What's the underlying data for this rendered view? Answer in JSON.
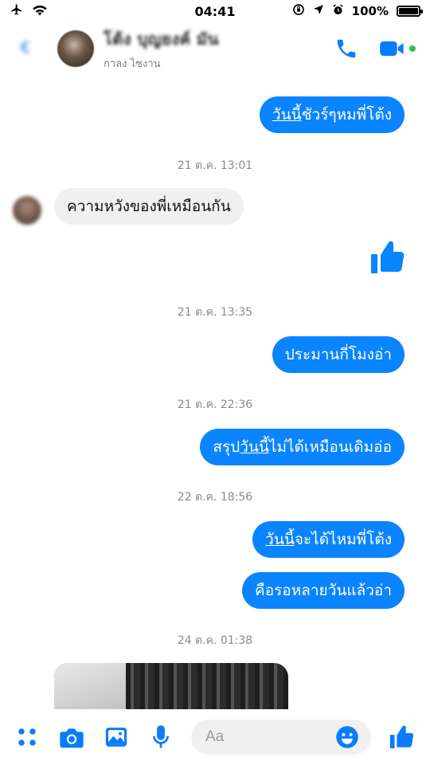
{
  "status_bar": {
    "time": "04:41",
    "battery_percent": "100%",
    "battery_level": 1.0,
    "icons": [
      "airplane-icon",
      "wifi-icon",
      "rotation-lock-icon",
      "location-icon",
      "alarm-icon",
      "battery-icon"
    ]
  },
  "header": {
    "contact_name": "โต้ง บุญยงค์ มัน",
    "contact_status": "กาลง ไซงาน",
    "icons": [
      "back-icon",
      "phone-icon",
      "video-call-icon"
    ],
    "accent_color": "#0a7cff",
    "active_color": "#31c24d"
  },
  "messages": {
    "m1": {
      "direction": "outgoing",
      "prefix": "วันนี้",
      "rest": "ชัวร์ๆหมพี่โต้ง"
    },
    "ts1": "21 ต.ค. 13:01",
    "m2": {
      "direction": "incoming",
      "text": "ความหวังของพี่เหมือนกัน"
    },
    "m3": {
      "direction": "outgoing",
      "type": "like-sticker"
    },
    "ts2": "21 ต.ค. 13:35",
    "m4": {
      "direction": "outgoing",
      "text": "ประมานกี่โมงอ่า"
    },
    "ts3": "21 ต.ค. 22:36",
    "m5": {
      "direction": "outgoing",
      "lead": "สรุป",
      "prefix": "วันนี้",
      "rest": "ไม่ได้เหมือนเดิมอ่อ"
    },
    "ts4": "22 ต.ค. 18:56",
    "m6": {
      "direction": "outgoing",
      "prefix": "วันนี้",
      "rest": "จะได้ไหมพี่โต้ง"
    },
    "m7": {
      "direction": "outgoing",
      "text": "คือรอหลายวันแล้วอ่า"
    },
    "ts5": "24 ต.ค. 01:38",
    "m8": {
      "direction": "incoming",
      "type": "photo"
    }
  },
  "composer": {
    "placeholder": "Aa",
    "icons": [
      "apps-icon",
      "camera-icon",
      "gallery-icon",
      "microphone-icon",
      "emoji-icon",
      "like-icon"
    ]
  },
  "colors": {
    "outgoing_bubble": "#0a84ff",
    "incoming_bubble": "#f0f0f0",
    "timestamp": "#8a8a8a"
  }
}
